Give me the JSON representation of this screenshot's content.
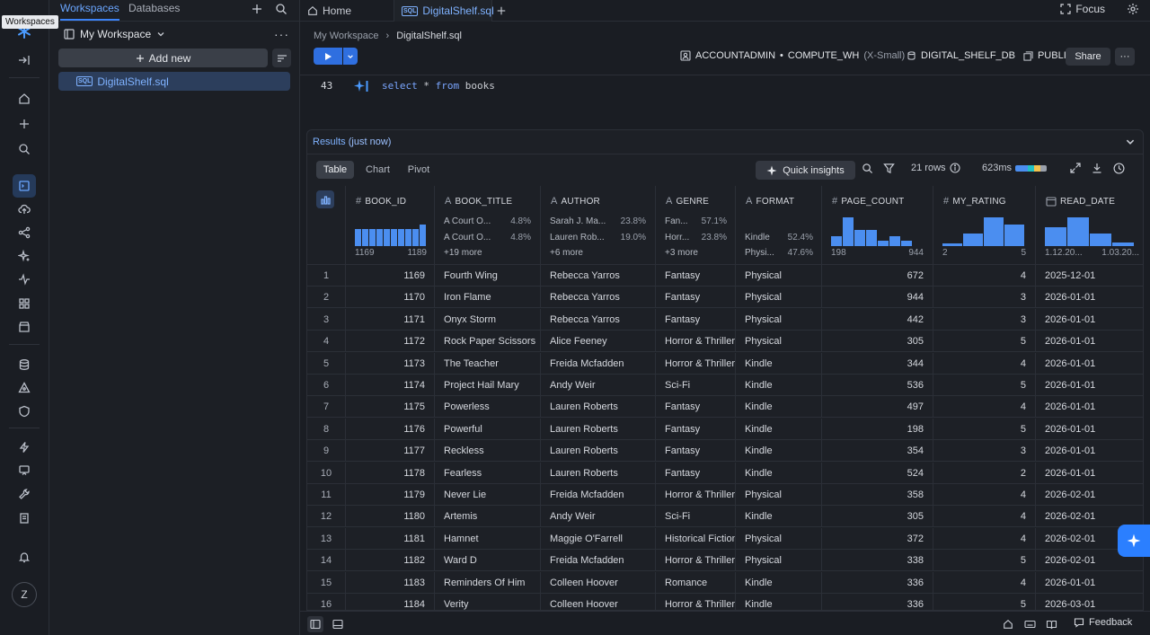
{
  "rail": {
    "tooltip": "Workspaces",
    "avatar_initial": "Z"
  },
  "sidebar": {
    "tabs": [
      "Workspaces",
      "Databases"
    ],
    "workspace_label": "My Workspace",
    "add_new_label": "Add new",
    "file_tag": "SQL",
    "file_name": "DigitalShelf.sql"
  },
  "tabs": {
    "home_label": "Home",
    "file_label": "DigitalShelf.sql",
    "file_tag": "SQL"
  },
  "topbar": {
    "focus_label": "Focus"
  },
  "breadcrumb": {
    "root": "My Workspace",
    "current": "DigitalShelf.sql"
  },
  "context": {
    "role": "ACCOUNTADMIN",
    "warehouse": "COMPUTE_WH",
    "warehouse_size": "(X-Small)",
    "database": "DIGITAL_SHELF_DB",
    "schema": "PUBLIC",
    "share_label": "Share"
  },
  "editor": {
    "line_number": "43",
    "kw1": "select",
    "star": " * ",
    "kw2": "from",
    "table": " books"
  },
  "results": {
    "title": "Results",
    "subtitle": "(just now)",
    "views": [
      "Table",
      "Chart",
      "Pivot"
    ],
    "quick_insights_label": "Quick insights",
    "row_count": "21 rows",
    "duration": "623ms",
    "timing_colors": [
      "#4b8ef0",
      "#22c1c3",
      "#f2c14e",
      "#9aa0ab"
    ],
    "accent_color": "#4b8ef0"
  },
  "columns": [
    {
      "name": "BOOK_ID",
      "type_icon": "#"
    },
    {
      "name": "BOOK_TITLE",
      "type_icon": "A"
    },
    {
      "name": "AUTHOR",
      "type_icon": "A"
    },
    {
      "name": "GENRE",
      "type_icon": "A"
    },
    {
      "name": "FORMAT",
      "type_icon": "A"
    },
    {
      "name": "PAGE_COUNT",
      "type_icon": "#"
    },
    {
      "name": "MY_RATING",
      "type_icon": "#"
    },
    {
      "name": "READ_DATE",
      "type_icon": "date"
    }
  ],
  "summaries": {
    "book_id": {
      "hist": [
        0.8,
        0.8,
        0.8,
        0.8,
        0.8,
        0.8,
        0.8,
        0.8,
        0.8,
        1.0
      ],
      "min": "1169",
      "max": "1189"
    },
    "book_title": {
      "top": [
        {
          "label": "A Court O...",
          "pct": "4.8%"
        },
        {
          "label": "A Court O...",
          "pct": "4.8%"
        }
      ],
      "more": "+19 more"
    },
    "author": {
      "top": [
        {
          "label": "Sarah J. Ma...",
          "pct": "23.8%"
        },
        {
          "label": "Lauren Rob...",
          "pct": "19.0%"
        }
      ],
      "more": "+6 more"
    },
    "genre": {
      "top": [
        {
          "label": "Fan...",
          "pct": "57.1%"
        },
        {
          "label": "Horr...",
          "pct": "23.8%"
        }
      ],
      "more": "+3 more"
    },
    "format": {
      "top": [
        {
          "label": "Kindle",
          "pct": "52.4%"
        },
        {
          "label": "Physi...",
          "pct": "47.6%"
        }
      ]
    },
    "page_count": {
      "hist": [
        0.35,
        1.0,
        0.55,
        0.55,
        0.2,
        0.35,
        0.2
      ],
      "min": "198",
      "max": "944"
    },
    "my_rating": {
      "hist": [
        0.1,
        0.45,
        1.0,
        0.75
      ],
      "min": "2",
      "max": "5"
    },
    "read_date": {
      "hist": [
        0.65,
        1.0,
        0.45,
        0.12
      ],
      "min": "1.12.20...",
      "max": "1.03.20..."
    }
  },
  "rows": [
    {
      "n": "1",
      "id": "1169",
      "title": "Fourth Wing",
      "author": "Rebecca Yarros",
      "genre": "Fantasy",
      "format": "Physical",
      "pages": "672",
      "rating": "4",
      "date": "2025-12-01"
    },
    {
      "n": "2",
      "id": "1170",
      "title": "Iron Flame",
      "author": "Rebecca Yarros",
      "genre": "Fantasy",
      "format": "Physical",
      "pages": "944",
      "rating": "3",
      "date": "2026-01-01"
    },
    {
      "n": "3",
      "id": "1171",
      "title": "Onyx Storm",
      "author": "Rebecca Yarros",
      "genre": "Fantasy",
      "format": "Physical",
      "pages": "442",
      "rating": "3",
      "date": "2026-01-01"
    },
    {
      "n": "4",
      "id": "1172",
      "title": "Rock Paper Scissors",
      "author": "Alice Feeney",
      "genre": "Horror & Thriller",
      "format": "Physical",
      "pages": "305",
      "rating": "5",
      "date": "2026-01-01"
    },
    {
      "n": "5",
      "id": "1173",
      "title": "The Teacher",
      "author": "Freida Mcfadden",
      "genre": "Horror & Thriller",
      "format": "Kindle",
      "pages": "344",
      "rating": "4",
      "date": "2026-01-01"
    },
    {
      "n": "6",
      "id": "1174",
      "title": "Project Hail Mary",
      "author": "Andy Weir",
      "genre": "Sci-Fi",
      "format": "Kindle",
      "pages": "536",
      "rating": "5",
      "date": "2026-01-01"
    },
    {
      "n": "7",
      "id": "1175",
      "title": "Powerless",
      "author": "Lauren Roberts",
      "genre": "Fantasy",
      "format": "Kindle",
      "pages": "497",
      "rating": "4",
      "date": "2026-01-01"
    },
    {
      "n": "8",
      "id": "1176",
      "title": "Powerful",
      "author": "Lauren Roberts",
      "genre": "Fantasy",
      "format": "Kindle",
      "pages": "198",
      "rating": "5",
      "date": "2026-01-01"
    },
    {
      "n": "9",
      "id": "1177",
      "title": "Reckless",
      "author": "Lauren Roberts",
      "genre": "Fantasy",
      "format": "Kindle",
      "pages": "354",
      "rating": "3",
      "date": "2026-01-01"
    },
    {
      "n": "10",
      "id": "1178",
      "title": "Fearless",
      "author": "Lauren Roberts",
      "genre": "Fantasy",
      "format": "Kindle",
      "pages": "524",
      "rating": "2",
      "date": "2026-01-01"
    },
    {
      "n": "11",
      "id": "1179",
      "title": "Never Lie",
      "author": "Freida Mcfadden",
      "genre": "Horror & Thriller",
      "format": "Physical",
      "pages": "358",
      "rating": "4",
      "date": "2026-02-01"
    },
    {
      "n": "12",
      "id": "1180",
      "title": "Artemis",
      "author": "Andy Weir",
      "genre": "Sci-Fi",
      "format": "Kindle",
      "pages": "305",
      "rating": "4",
      "date": "2026-02-01"
    },
    {
      "n": "13",
      "id": "1181",
      "title": "Hamnet",
      "author": "Maggie O'Farrell",
      "genre": "Historical Fiction",
      "format": "Physical",
      "pages": "372",
      "rating": "4",
      "date": "2026-02-01"
    },
    {
      "n": "14",
      "id": "1182",
      "title": "Ward D",
      "author": "Freida Mcfadden",
      "genre": "Horror & Thriller",
      "format": "Physical",
      "pages": "338",
      "rating": "5",
      "date": "2026-02-01"
    },
    {
      "n": "15",
      "id": "1183",
      "title": "Reminders Of Him",
      "author": "Colleen Hoover",
      "genre": "Romance",
      "format": "Kindle",
      "pages": "336",
      "rating": "4",
      "date": "2026-01-01"
    },
    {
      "n": "16",
      "id": "1184",
      "title": "Verity",
      "author": "Colleen Hoover",
      "genre": "Horror & Thriller",
      "format": "Kindle",
      "pages": "336",
      "rating": "5",
      "date": "2026-03-01"
    }
  ],
  "footer": {
    "feedback_label": "Feedback"
  }
}
